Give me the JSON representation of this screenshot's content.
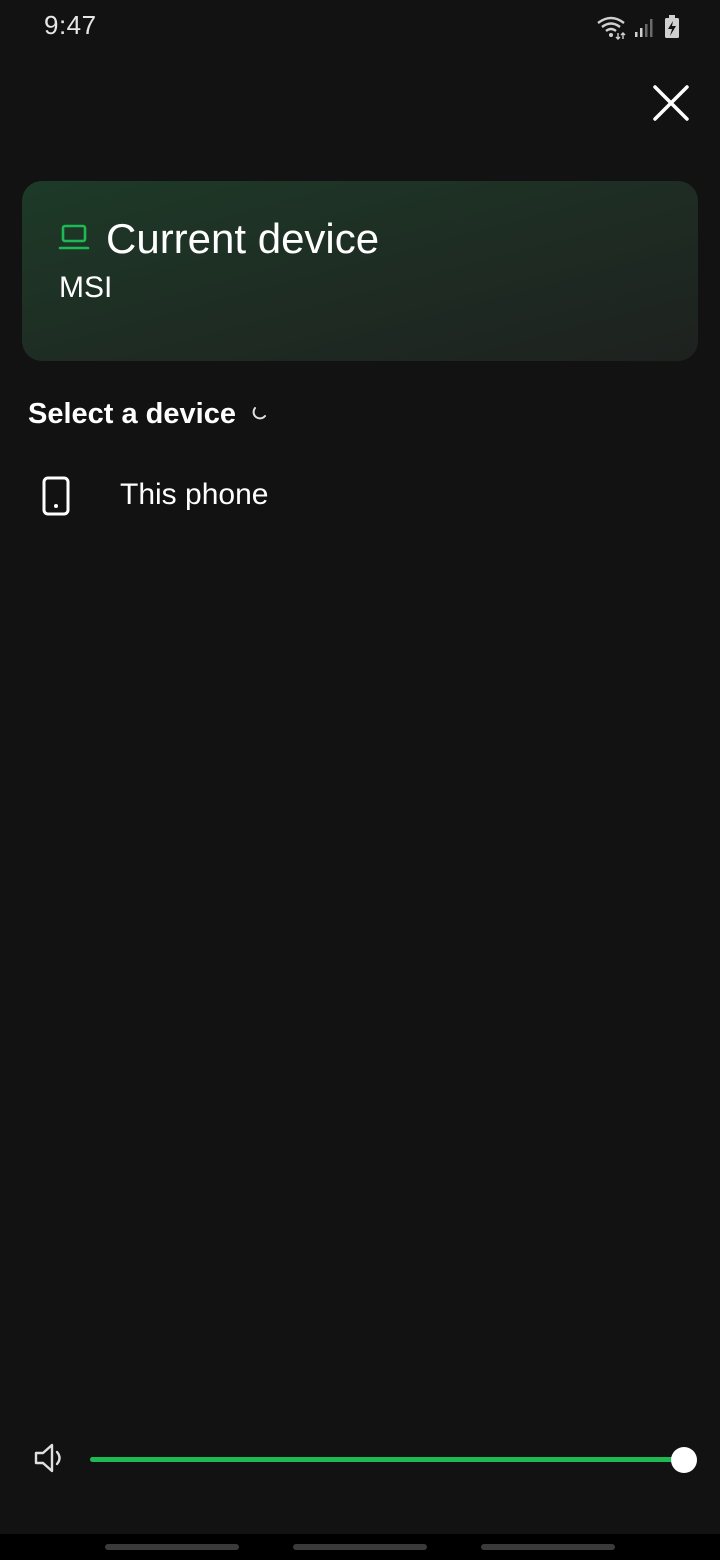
{
  "status_bar": {
    "time": "9:47",
    "icons": [
      "wifi-icon",
      "signal-icon",
      "battery-charging-icon"
    ]
  },
  "close_icon": "close-icon",
  "current_device": {
    "heading": "Current device",
    "name": "MSI",
    "icon": "laptop-icon",
    "accent_color": "#1db954"
  },
  "select_section": {
    "title": "Select a device",
    "loading_icon": "spinner-icon"
  },
  "devices": [
    {
      "label": "This phone",
      "icon": "phone-icon"
    }
  ],
  "volume": {
    "icon": "speaker-icon",
    "level": 1.0,
    "fill_color": "#1db954"
  },
  "colors": {
    "background": "#121212",
    "accent": "#1db954",
    "text": "#ffffff"
  }
}
